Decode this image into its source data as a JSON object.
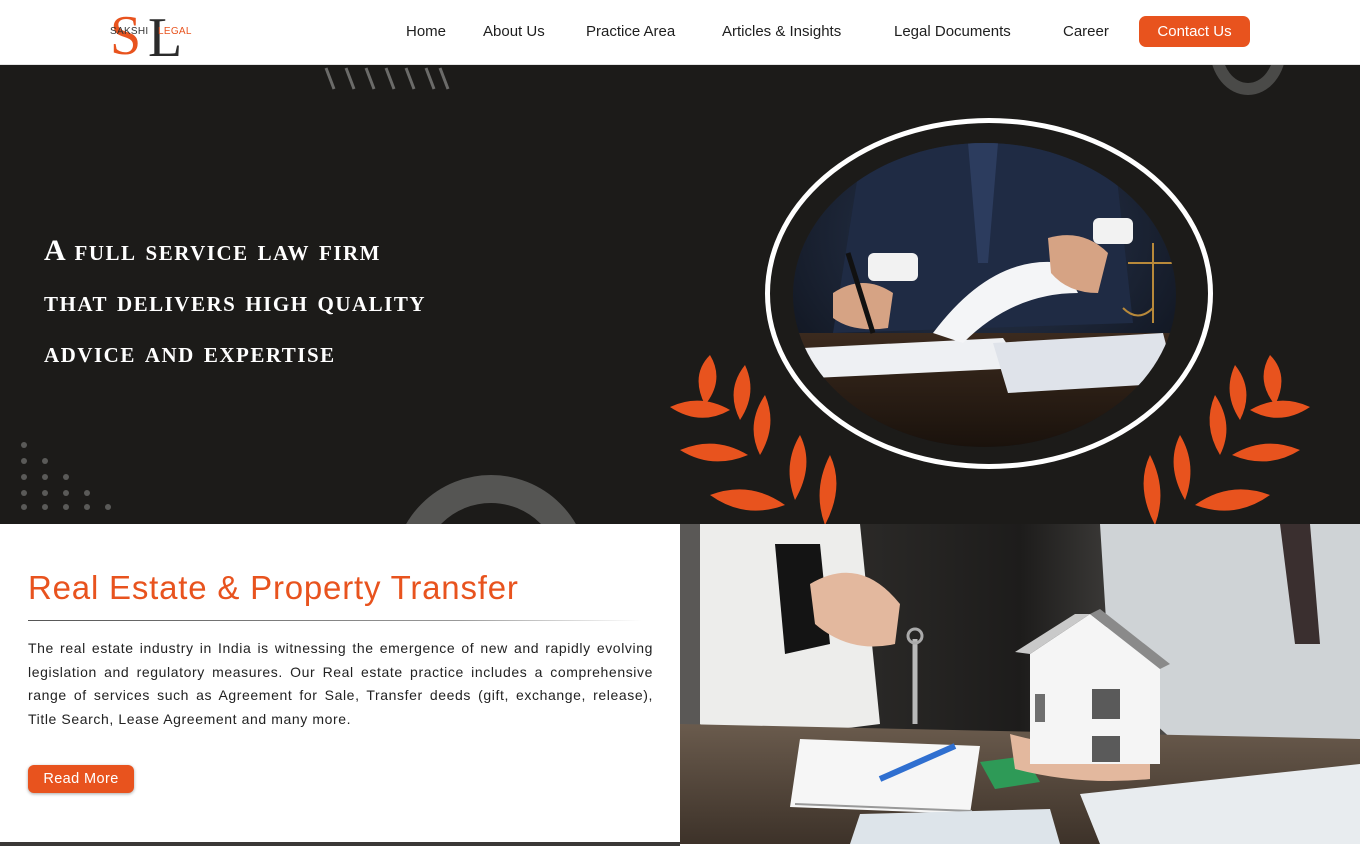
{
  "brand": {
    "logo_letters": "SL",
    "logo_left": "SAKSHI",
    "logo_right": "LEGAL",
    "accent": "#e8531e",
    "dark": "#1c1b19"
  },
  "nav": {
    "items": [
      {
        "label": "Home"
      },
      {
        "label": "About Us"
      },
      {
        "label": "Practice Area"
      },
      {
        "label": "Articles & Insights"
      },
      {
        "label": "Legal Documents"
      },
      {
        "label": "Career"
      }
    ],
    "contact_label": "Contact Us"
  },
  "hero": {
    "lines": [
      "A full service law firm",
      "that delivers high quality",
      "advice and expertise"
    ]
  },
  "practice": {
    "title": "Real Estate & Property Transfer",
    "body": "The real estate industry in India is witnessing the emergence of new and rapidly evolving legislation and regulatory measures. Our Real estate practice includes a comprehensive range of services such as Agreement for Sale, Transfer deeds (gift, exchange, release), Title Search, Lease Agreement and many more.",
    "button": "Read More"
  }
}
